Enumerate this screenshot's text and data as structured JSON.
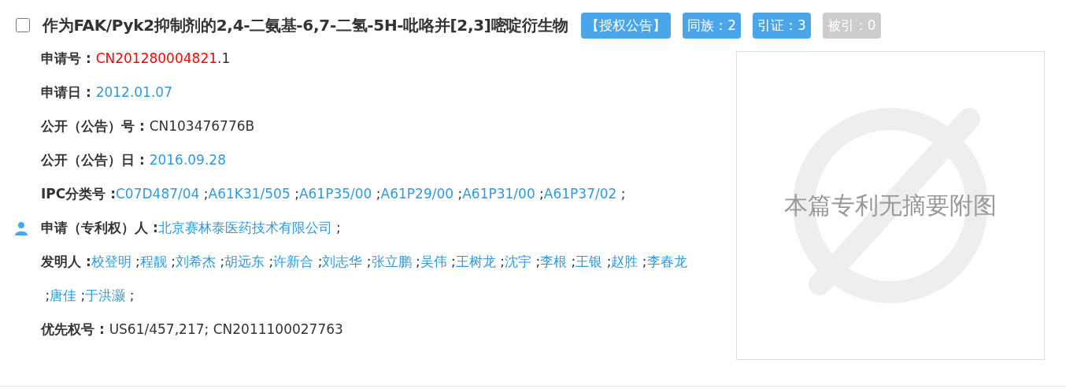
{
  "result": {
    "checked": false,
    "title": "作为FAK/Pyk2抑制剂的2,4-二氨基-6,7-二氢-5H-吡咯并[2,3]嘧啶衍生物",
    "badges": [
      {
        "text": "【授权公告】",
        "disabled": false
      },
      {
        "text": "同族：2",
        "disabled": false
      },
      {
        "text": "引证：3",
        "disabled": false
      },
      {
        "text": "被引：0",
        "disabled": true
      }
    ],
    "fields": [
      {
        "kind": "plain",
        "label": "申请号 : ",
        "parts": [
          {
            "kind": "highlight",
            "text": "CN201280004821"
          },
          {
            "kind": "plain",
            "text": ".1"
          }
        ]
      },
      {
        "kind": "plain",
        "label": "申请日 : ",
        "parts": [
          {
            "kind": "link",
            "text": "2012.01.07"
          }
        ]
      },
      {
        "kind": "plain",
        "label": "公开（公告）号 : ",
        "parts": [
          {
            "kind": "plain",
            "text": "CN103476776B"
          }
        ]
      },
      {
        "kind": "plain",
        "label": "公开（公告）日 : ",
        "parts": [
          {
            "kind": "link",
            "text": "2016.09.28"
          }
        ]
      },
      {
        "kind": "plain",
        "label": "IPC分类号 :",
        "parts": [
          {
            "kind": "link",
            "text": "C07D487/04"
          },
          {
            "kind": "plain",
            "text": " ;"
          },
          {
            "kind": "link",
            "text": "A61K31/505"
          },
          {
            "kind": "plain",
            "text": " ;"
          },
          {
            "kind": "link",
            "text": "A61P35/00"
          },
          {
            "kind": "plain",
            "text": " ;"
          },
          {
            "kind": "link",
            "text": "A61P29/00"
          },
          {
            "kind": "plain",
            "text": " ;"
          },
          {
            "kind": "link",
            "text": "A61P31/00"
          },
          {
            "kind": "plain",
            "text": " ;"
          },
          {
            "kind": "link",
            "text": "A61P37/02"
          },
          {
            "kind": "plain",
            "text": " ;"
          }
        ]
      },
      {
        "kind": "party",
        "label": "申请（专利权）人 :",
        "parts": [
          {
            "kind": "link",
            "text": "北京赛林泰医药技术有限公司"
          },
          {
            "kind": "plain",
            "text": " ;"
          }
        ]
      },
      {
        "kind": "plain",
        "label": "发明人 :",
        "parts": [
          {
            "kind": "link",
            "text": "校登明"
          },
          {
            "kind": "plain",
            "text": " ;"
          },
          {
            "kind": "link",
            "text": "程靓"
          },
          {
            "kind": "plain",
            "text": " ;"
          },
          {
            "kind": "link",
            "text": "刘希杰"
          },
          {
            "kind": "plain",
            "text": " ;"
          },
          {
            "kind": "link",
            "text": "胡远东"
          },
          {
            "kind": "plain",
            "text": " ;"
          },
          {
            "kind": "link",
            "text": "许新合"
          },
          {
            "kind": "plain",
            "text": " ;"
          },
          {
            "kind": "link",
            "text": "刘志华"
          },
          {
            "kind": "plain",
            "text": " ;"
          },
          {
            "kind": "link",
            "text": "张立鹏"
          },
          {
            "kind": "plain",
            "text": " ;"
          },
          {
            "kind": "link",
            "text": "吴伟"
          },
          {
            "kind": "plain",
            "text": " ;"
          },
          {
            "kind": "link",
            "text": "王树龙"
          },
          {
            "kind": "plain",
            "text": " ;"
          },
          {
            "kind": "link",
            "text": "沈宇"
          },
          {
            "kind": "plain",
            "text": " ;"
          },
          {
            "kind": "link",
            "text": "李根"
          },
          {
            "kind": "plain",
            "text": " ;"
          },
          {
            "kind": "link",
            "text": "王银"
          },
          {
            "kind": "plain",
            "text": " ;"
          },
          {
            "kind": "link",
            "text": "赵胜"
          },
          {
            "kind": "plain",
            "text": " ;"
          },
          {
            "kind": "link",
            "text": "李春龙"
          },
          {
            "kind": "plain",
            "text": " ;"
          },
          {
            "kind": "link",
            "text": "唐佳"
          },
          {
            "kind": "plain",
            "text": " ;"
          },
          {
            "kind": "link",
            "text": "于洪灏"
          },
          {
            "kind": "plain",
            "text": " ;"
          }
        ]
      },
      {
        "kind": "plain",
        "label": "优先权号 : ",
        "parts": [
          {
            "kind": "plain",
            "text": "US61/457,217; CN2011100027763"
          }
        ]
      }
    ],
    "abstract_image": {
      "text": "本篇专利无摘要附图"
    }
  }
}
